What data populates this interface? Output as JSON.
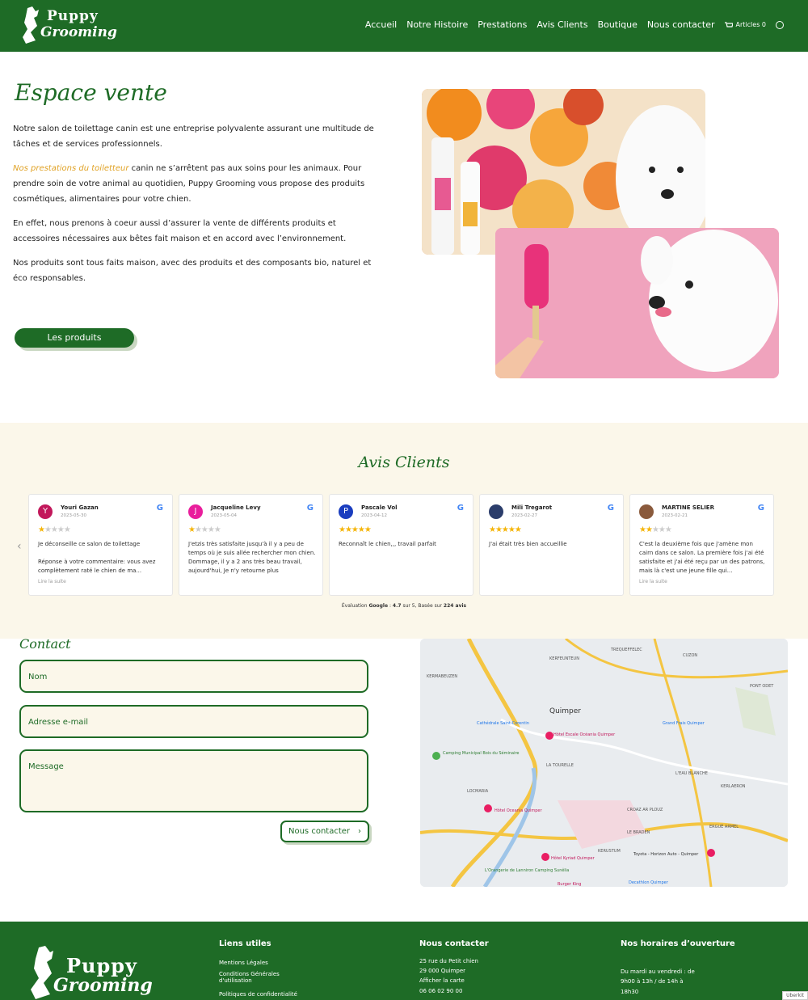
{
  "brand": {
    "line1": "Puppy",
    "line2": "Grooming"
  },
  "nav": {
    "items": [
      "Accueil",
      "Notre Histoire",
      "Prestations",
      "Avis Clients",
      "Boutique",
      "Nous contacter"
    ],
    "cart_label": "Articles 0"
  },
  "espace_vente": {
    "title": "Espace vente",
    "p1": "Notre salon de toilettage canin est une entreprise polyvalente assurant une multitude de tâches et de services professionnels.",
    "p2_link": "Nos prestations du toiletteur",
    "p2_rest": " canin ne s’arrêtent pas aux soins pour les animaux. Pour prendre soin de votre animal au quotidien, Puppy Grooming vous propose des produits cosmétiques, alimentaires pour votre chien.",
    "p3": "En effet, nous prenons à coeur aussi d’assurer la vente de différents produits et accessoires nécessaires aux bêtes fait maison et en accord avec l’environnement.",
    "p4": "Nos produits sont tous faits maison, avec des produits et des composants bio, naturel et éco responsables.",
    "button": "Les produits"
  },
  "avis": {
    "title": "Avis Clients",
    "reviews": [
      {
        "initial": "Y",
        "name": "Youri Gazan",
        "date": "2023-05-30",
        "rating": 1,
        "text": "Je déconseille ce salon de toilettage",
        "reply": "Réponse à votre commentaire: vous avez complètement raté le chien de ma...",
        "more": "Lire la suite",
        "color": "#c2185b"
      },
      {
        "initial": "J",
        "name": "Jacqueline Levy",
        "date": "2023-05-04",
        "rating": 1,
        "text": "J'etzis très satisfaite jusqu'à il y a peu de temps où je suis allée rechercher mon chien. Dommage, il y a 2 ans très beau travail, aujourd'hui, Je n'y retourne plus",
        "color": "#e91e9c"
      },
      {
        "initial": "P",
        "name": "Pascale Vol",
        "date": "2023-04-12",
        "rating": 5,
        "text": "Reconnaît le chien,,, travail parfait",
        "color": "#1a3dbf"
      },
      {
        "initial": "",
        "name": "Mili Tregarot",
        "date": "2023-02-27",
        "rating": 5,
        "text": "J'ai était très bien accueillie",
        "color": "#2b3d6b"
      },
      {
        "initial": "",
        "name": "MARTINE SELIER",
        "date": "2023-02-21",
        "rating": 2,
        "text": "C'est la deuxième fois que j'amène mon cairn dans ce salon. La première fois j'ai été satisfaite et j'ai été reçu par un des patrons, mais là c'est une jeune fille qui...",
        "more": "Lire la suite",
        "color": "#8a5a3c"
      }
    ],
    "eval_prefix": "Évaluation",
    "eval_brand": "Google",
    "eval_score": "4.7",
    "eval_mid": "sur 5, Basée sur",
    "eval_count": "224 avis"
  },
  "contact": {
    "title": "Contact",
    "name_placeholder": "Nom",
    "email_placeholder": "Adresse e-mail",
    "message_placeholder": "Message",
    "button": "Nous contacter"
  },
  "map": {
    "labels": [
      "KERFEUNTEUN",
      "TREQUEFFELEC",
      "CUZON",
      "KERMABEUZEN",
      "PONT ODET",
      "Quimper",
      "Cathédrale Saint-Corentin",
      "Hôtel Escale Océania Quimper",
      "Grand Frais Quimper",
      "Camping Municipal Bois du Séminaire",
      "LA TOURELLE",
      "L'EAU BLANCHE",
      "KERLAERON",
      "LOCMARIA",
      "Hôtel Oceania Quimper",
      "CROAZ AR PLOUZ",
      "ERGUÉ ARMEL",
      "LE BRADEN",
      "KERUSTUM",
      "Toyota - Horizon Auto - Quimper",
      "Hôtel Kyriad Quimper",
      "L'Orangerie de Lanniron Camping Sunêlia",
      "Decathlon Quimper",
      "Burger King"
    ]
  },
  "footer": {
    "col1_title": "Liens utiles",
    "col1_items": [
      "Mentions Légales",
      "Conditions Générales d'utilisation",
      "Politiques de confidentialité"
    ],
    "col2_title": "Nous contacter",
    "col2_items": [
      "25 rue du Petit chien",
      "29 000 Quimper",
      "Afficher la carte",
      "06 06 02 90 00"
    ],
    "col3_title": "Nos horaires d’ouverture",
    "col3_items": [
      "Du mardi au vendredi : de",
      "9h00 à 13h / de 14h à",
      "18h30"
    ],
    "uberlink": "Uberkit"
  },
  "colors": {
    "brand_green": "#1e6b26",
    "accent_gold": "#e0a225",
    "cream": "#fbf7ea"
  }
}
